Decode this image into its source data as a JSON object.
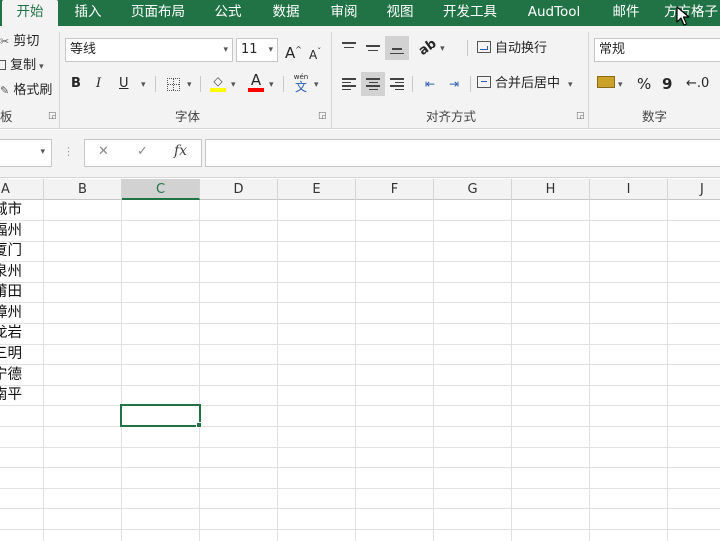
{
  "tabs": [
    {
      "label": "开始",
      "active": true
    },
    {
      "label": "插入"
    },
    {
      "label": "页面布局"
    },
    {
      "label": "公式"
    },
    {
      "label": "数据"
    },
    {
      "label": "审阅"
    },
    {
      "label": "视图"
    },
    {
      "label": "开发工具"
    },
    {
      "label": "AudTool"
    },
    {
      "label": "邮件"
    },
    {
      "label": "方方格子"
    }
  ],
  "clipboard": {
    "cut": "剪切",
    "copy": "复制",
    "format_painter": "格式刷",
    "group_label": "板"
  },
  "font": {
    "name": "等线",
    "size": "11",
    "increase_label": "A",
    "decrease_label": "A",
    "bold": "B",
    "italic": "I",
    "underline": "U",
    "font_color_label": "A",
    "phonetic_top": "wén",
    "phonetic_bottom": "文",
    "group_label": "字体"
  },
  "alignment": {
    "wrap_text": "自动换行",
    "merge_center": "合并后居中",
    "group_label": "对齐方式"
  },
  "number": {
    "format": "常规",
    "percent": "%",
    "comma": "9",
    "group_label": "数字"
  },
  "formula_bar": {
    "cancel": "✕",
    "enter": "✓",
    "fx": "fx",
    "value": ""
  },
  "grid": {
    "columns": [
      "A",
      "B",
      "C",
      "D",
      "E",
      "F",
      "G",
      "H",
      "I",
      "J"
    ],
    "selected_column": "C",
    "column_a_values": [
      "城市",
      "福州",
      "厦门",
      "泉州",
      "莆田",
      "漳州",
      "龙岩",
      "三明",
      "宁德",
      "南平"
    ]
  },
  "colors": {
    "accent": "#217346",
    "ribbon_bg": "#f3f3f3",
    "gridline": "#e1e1e1"
  }
}
